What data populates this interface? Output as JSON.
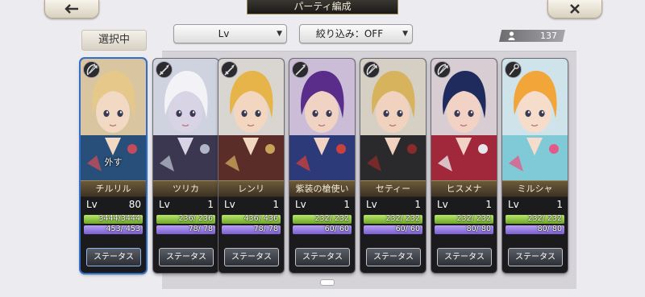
{
  "header": {
    "title": "パーティ編成",
    "back_icon": "arrow-left-icon",
    "close_icon": "close-icon"
  },
  "selected_label": "選択中",
  "sort": {
    "value": "Lv"
  },
  "filter": {
    "value": "絞り込み：OFF"
  },
  "unit_count": "137",
  "status_label": "ステータス",
  "remove_label": "外す",
  "lv_label": "Lv",
  "colors": {
    "selected_border": "#2f6ec9",
    "hp": "#8cc63f",
    "sp": "#9a7fe0"
  },
  "cards": [
    {
      "name": "チルリル",
      "lv": "80",
      "hp": "3444/3444",
      "sp": "453/ 453",
      "weapon": "bow-icon",
      "selected": true,
      "palette": {
        "bg": "#d9c6a0",
        "hair": "#e6c98a",
        "skin": "#f2d9c4",
        "outfit": "#274f7a",
        "accent": "#c44b5a"
      }
    },
    {
      "name": "ツリカ",
      "lv": "1",
      "hp": "236/ 236",
      "sp": "78/ 78",
      "weapon": "sword-icon",
      "selected": false,
      "palette": {
        "bg": "#cfd3df",
        "hair": "#f2f2f7",
        "skin": "#d8d4e6",
        "outfit": "#3b3750",
        "accent": "#b0b6c8"
      }
    },
    {
      "name": "レンリ",
      "lv": "1",
      "hp": "436/ 436",
      "sp": "78/ 78",
      "weapon": "sword-icon",
      "selected": false,
      "palette": {
        "bg": "#d9d6d2",
        "hair": "#e7b44a",
        "skin": "#f3d6c0",
        "outfit": "#5b2d28",
        "accent": "#c8a35a"
      }
    },
    {
      "name": "紫装の槍使い",
      "lv": "1",
      "hp": "232/ 232",
      "sp": "60/ 60",
      "weapon": "spear-icon",
      "selected": false,
      "palette": {
        "bg": "#cbbdd8",
        "hair": "#5a2d8a",
        "skin": "#f1d3c3",
        "outfit": "#2c3a7a",
        "accent": "#c9403d"
      }
    },
    {
      "name": "セティー",
      "lv": "1",
      "hp": "232/ 232",
      "sp": "60/ 60",
      "weapon": "bow-icon",
      "selected": false,
      "palette": {
        "bg": "#d6d0c4",
        "hair": "#d7b35e",
        "skin": "#f0d2be",
        "outfit": "#2a2a2c",
        "accent": "#8a2a2a"
      }
    },
    {
      "name": "ヒスメナ",
      "lv": "1",
      "hp": "232/ 232",
      "sp": "80/ 80",
      "weapon": "bow-icon",
      "selected": false,
      "palette": {
        "bg": "#d8cdd2",
        "hair": "#1f2b5c",
        "skin": "#f2d2c4",
        "outfit": "#a0283a",
        "accent": "#e6e6ea"
      }
    },
    {
      "name": "ミルシャ",
      "lv": "1",
      "hp": "232/ 232",
      "sp": "80/ 80",
      "weapon": "staff-icon",
      "selected": false,
      "palette": {
        "bg": "#cfe4ea",
        "hair": "#f2a63a",
        "skin": "#f6dccb",
        "outfit": "#7fcad6",
        "accent": "#e35a8a"
      }
    }
  ]
}
